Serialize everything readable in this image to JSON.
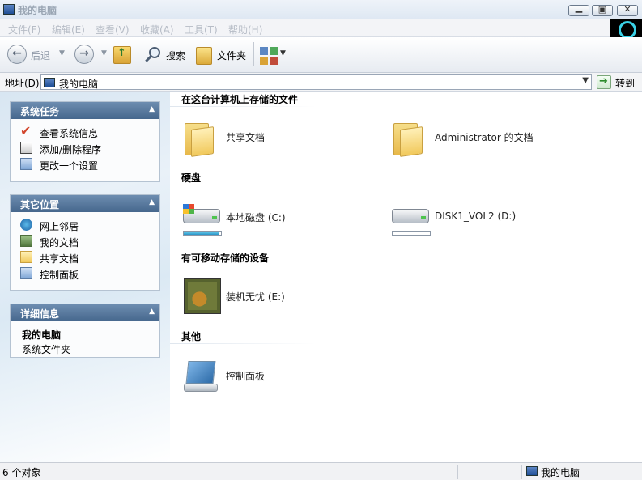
{
  "window": {
    "title": "我的电脑"
  },
  "menu": {
    "items": [
      "文件(F)",
      "编辑(E)",
      "查看(V)",
      "收藏(A)",
      "工具(T)",
      "帮助(H)"
    ]
  },
  "toolbar": {
    "back_label": "后退",
    "search_label": "搜索",
    "folders_label": "文件夹"
  },
  "address": {
    "label": "地址(D)",
    "value": "我的电脑",
    "go_label": "转到"
  },
  "sidebar": {
    "system_tasks": {
      "title": "系统任务",
      "items": [
        {
          "label": "查看系统信息",
          "icon": "checkmark-icon"
        },
        {
          "label": "添加/删除程序",
          "icon": "add-remove-programs-icon"
        },
        {
          "label": "更改一个设置",
          "icon": "control-panel-icon"
        }
      ]
    },
    "other_places": {
      "title": "其它位置",
      "items": [
        {
          "label": "网上邻居",
          "icon": "network-icon"
        },
        {
          "label": "我的文档",
          "icon": "my-documents-icon"
        },
        {
          "label": "共享文档",
          "icon": "folder-icon"
        },
        {
          "label": "控制面板",
          "icon": "control-panel-icon"
        }
      ]
    },
    "details": {
      "title": "详细信息",
      "name": "我的电脑",
      "type": "系统文件夹"
    }
  },
  "main": {
    "groups": {
      "stored_files": {
        "title": "在这台计算机上存储的文件",
        "items": [
          "共享文档",
          "Administrator 的文档"
        ]
      },
      "hard_drives": {
        "title": "硬盘",
        "items": [
          {
            "label": "本地磁盘 (C:)",
            "used_fraction": 0.95
          },
          {
            "label": "DISK1_VOL2 (D:)",
            "used_fraction": 0.0
          }
        ]
      },
      "removable": {
        "title": "有可移动存储的设备",
        "items": [
          "装机无忧 (E:)"
        ]
      },
      "other": {
        "title": "其他",
        "items": [
          "控制面板"
        ]
      }
    }
  },
  "status": {
    "count": "6 个对象",
    "location": "我的电脑"
  }
}
